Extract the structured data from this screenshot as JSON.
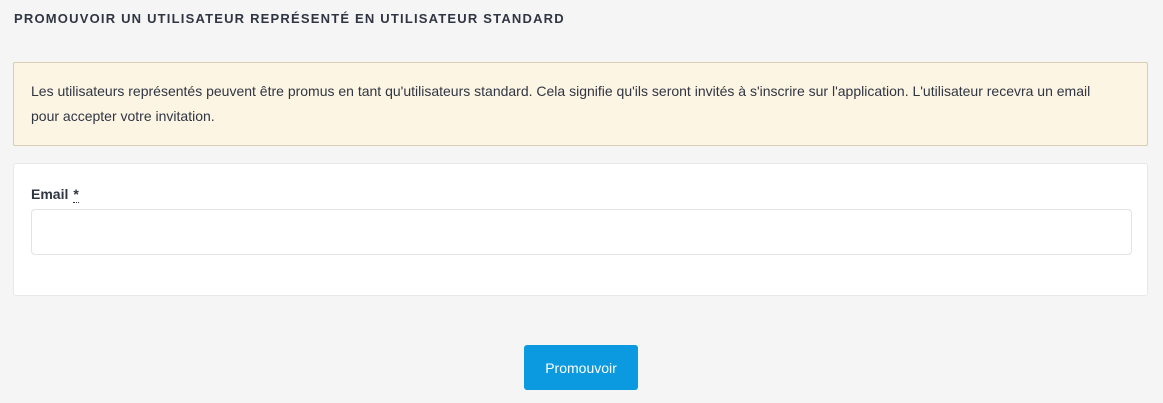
{
  "page": {
    "title": "PROMOUVOIR UN UTILISATEUR REPRÉSENTÉ EN UTILISATEUR STANDARD"
  },
  "notice": {
    "text": "Les utilisateurs représentés peuvent être promus en tant qu'utilisateurs standard. Cela signifie qu'ils seront invités à s'inscrire sur l'application. L'utilisateur recevra un email pour accepter votre invitation."
  },
  "form": {
    "email_label": "Email",
    "required_mark": "*",
    "email_value": "",
    "email_placeholder": ""
  },
  "actions": {
    "promote_label": "Promouvoir"
  },
  "colors": {
    "background": "#f5f5f5",
    "notice_background": "#fdf5e4",
    "primary_button": "#0b9ae0"
  }
}
